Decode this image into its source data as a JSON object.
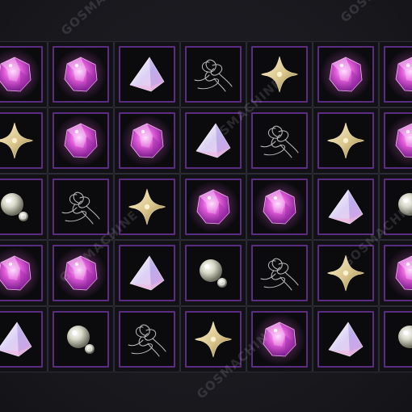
{
  "watermark": "GOSMACHINE",
  "grid": {
    "rows": [
      [
        "crystal-gem-icon",
        "crystal-gem-icon",
        "prism-gem-icon",
        "thread-bundle-icon",
        "gold-star-icon",
        "crystal-gem-icon",
        "crystal-gem-icon"
      ],
      [
        "gold-star-icon",
        "crystal-gem-icon",
        "crystal-gem-icon",
        "prism-gem-icon",
        "thread-bundle-icon",
        "gold-star-icon",
        "crystal-gem-icon"
      ],
      [
        "pearl-icon",
        "thread-bundle-icon",
        "gold-star-icon",
        "crystal-gem-icon",
        "crystal-gem-icon",
        "prism-gem-icon",
        "pearl-icon"
      ],
      [
        "crystal-gem-icon",
        "crystal-gem-icon",
        "prism-gem-icon",
        "pearl-icon",
        "thread-bundle-icon",
        "gold-star-icon",
        "crystal-gem-icon"
      ],
      [
        "prism-gem-icon",
        "pearl-icon",
        "thread-bundle-icon",
        "gold-star-icon",
        "crystal-gem-icon",
        "prism-gem-icon",
        "pearl-icon"
      ]
    ]
  },
  "colors": {
    "background": "#1b1b21",
    "slot_border": "#5a2d83",
    "crystal": "#e05ad8",
    "prism": "#c9b8f0",
    "gold": "#d8c48a",
    "pearl": "#d8d8c8",
    "thread": "#c8c8c8"
  }
}
